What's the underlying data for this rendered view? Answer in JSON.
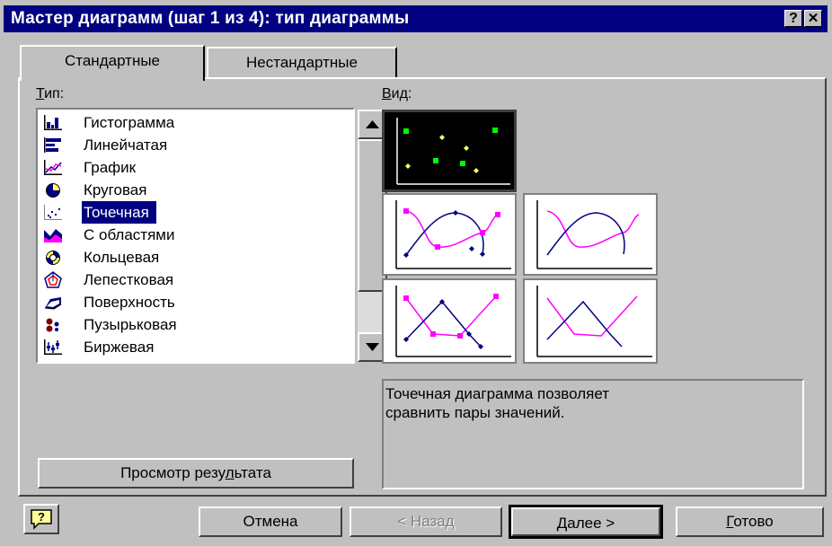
{
  "title": "Мастер диаграмм (шаг 1 из 4): тип диаграммы",
  "title_buttons": {
    "help": "?",
    "close": "✕"
  },
  "tabs": [
    {
      "label": "Стандартные",
      "active": true
    },
    {
      "label": "Нестандартные",
      "active": false
    }
  ],
  "type_section": {
    "label_underlined": "Т",
    "label_rest": "ип:"
  },
  "chart_types": [
    {
      "label": "Гистограмма",
      "icon": "column-chart-icon"
    },
    {
      "label": "Линейчатая",
      "icon": "bar-chart-icon"
    },
    {
      "label": "График",
      "icon": "line-chart-icon"
    },
    {
      "label": "Круговая",
      "icon": "pie-chart-icon"
    },
    {
      "label": "Точечная",
      "icon": "scatter-chart-icon",
      "selected": true
    },
    {
      "label": "С областями",
      "icon": "area-chart-icon"
    },
    {
      "label": "Кольцевая",
      "icon": "doughnut-chart-icon"
    },
    {
      "label": "Лепестковая",
      "icon": "radar-chart-icon"
    },
    {
      "label": "Поверхность",
      "icon": "surface-chart-icon"
    },
    {
      "label": "Пузырьковая",
      "icon": "bubble-chart-icon"
    },
    {
      "label": "Биржевая",
      "icon": "stock-chart-icon"
    }
  ],
  "view_section": {
    "label_underlined": "В",
    "label_rest": "ид:"
  },
  "subtypes": [
    {
      "name": "scatter-markers",
      "selected": true
    },
    {
      "name": "scatter-smooth-markers",
      "selected": false
    },
    {
      "name": "scatter-smooth-lines",
      "selected": false
    },
    {
      "name": "scatter-lines-markers",
      "selected": false
    },
    {
      "name": "scatter-lines",
      "selected": false
    }
  ],
  "description": "Точечная диаграмма позволяет\nсравнить пары значений.",
  "preview_button": {
    "pre": "Просмотр резу",
    "ul": "л",
    "post": "ьтата"
  },
  "buttons": {
    "cancel": "Отмена",
    "back": "< Назад",
    "next": "Далее >",
    "finish_ul": "Г",
    "finish_rest": "отово"
  },
  "colors": {
    "title_bg": "#000080",
    "face": "#c0c0c0",
    "selection": "#000080",
    "series_a": "#ff00ff",
    "series_b": "#000080",
    "marker_green": "#00ff00",
    "marker_yellow": "#ffff66"
  }
}
